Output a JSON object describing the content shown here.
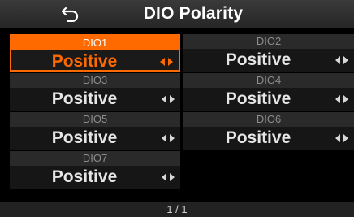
{
  "header": {
    "title": "DIO Polarity",
    "back_icon": "return-arrow-icon"
  },
  "items": [
    {
      "name": "DIO1",
      "value": "Positive",
      "selected": true
    },
    {
      "name": "DIO2",
      "value": "Positive",
      "selected": false
    },
    {
      "name": "DIO3",
      "value": "Positive",
      "selected": false
    },
    {
      "name": "DIO4",
      "value": "Positive",
      "selected": false
    },
    {
      "name": "DIO5",
      "value": "Positive",
      "selected": false
    },
    {
      "name": "DIO6",
      "value": "Positive",
      "selected": false
    },
    {
      "name": "DIO7",
      "value": "Positive",
      "selected": false
    }
  ],
  "footer": {
    "page": "1 / 1"
  },
  "colors": {
    "accent": "#ff6a00",
    "background": "#000000",
    "header": "#2e2e2e"
  }
}
